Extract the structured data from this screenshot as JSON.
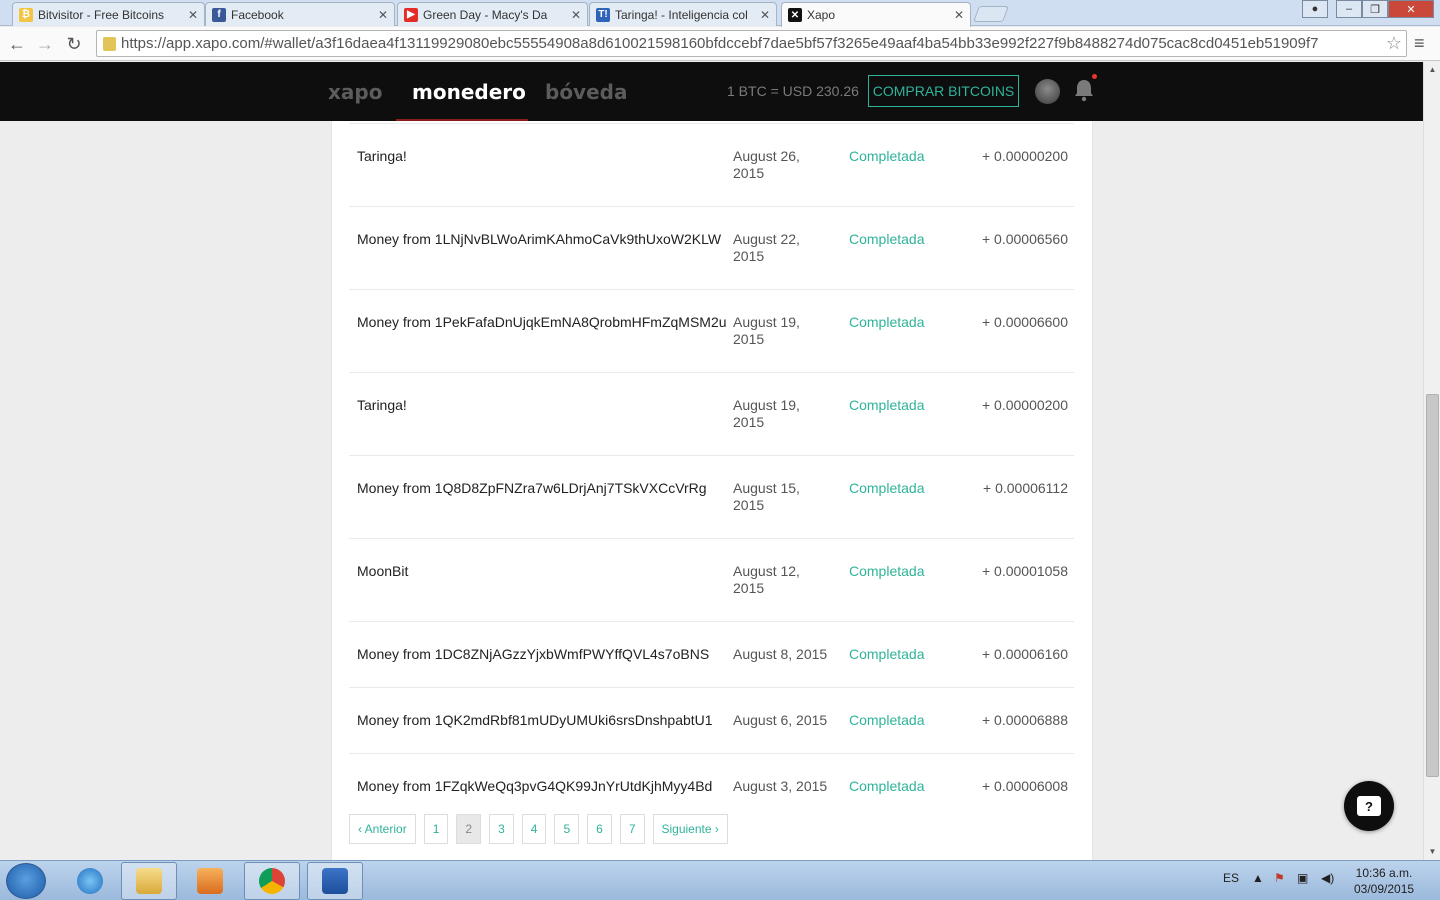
{
  "browser": {
    "tabs": [
      {
        "label": "Bitvisitor - Free Bitcoins",
        "icon": "bitvisitor-icon",
        "color": "#f4c542",
        "glyph": "₿"
      },
      {
        "label": "Facebook",
        "icon": "facebook-icon",
        "color": "#3b5998",
        "glyph": "f"
      },
      {
        "label": "Green Day - Macy's Da",
        "icon": "youtube-icon",
        "color": "#e52d27",
        "glyph": "▶"
      },
      {
        "label": "Taringa! - Inteligencia col",
        "icon": "taringa-icon",
        "color": "#2d63b8",
        "glyph": "T!"
      },
      {
        "label": "Xapo",
        "icon": "xapo-icon",
        "color": "#111111",
        "glyph": "✕"
      }
    ],
    "url": "https://app.xapo.com/#wallet/a3f16daea4f13119929080ebc55554908a8d610021598160bfdccebf7dae5bf57f3265e49aaf4ba54bb33e992f227f9b8488274d075cac8cd0451eb51909f7"
  },
  "header": {
    "brand_xapo": "xapo",
    "brand_monedero": "monedero",
    "brand_boveda": "bóveda",
    "rate": "1 BTC = USD 230.26",
    "buy_label": "COMPRAR BITCOINS",
    "accent": "#2fb39a"
  },
  "transactions": [
    {
      "desc": "Taringa!",
      "date": "August 26, 2015",
      "status": "Completada",
      "amount": "+ 0.00000200"
    },
    {
      "desc": "Money from 1LNjNvBLWoArimKAhmoCaVk9thUxoW2KLW",
      "date": "August 22, 2015",
      "status": "Completada",
      "amount": "+ 0.00006560"
    },
    {
      "desc": "Money from 1PekFafaDnUjqkEmNA8QrobmHFmZqMSM2u",
      "date": "August 19, 2015",
      "status": "Completada",
      "amount": "+ 0.00006600"
    },
    {
      "desc": "Taringa!",
      "date": "August 19, 2015",
      "status": "Completada",
      "amount": "+ 0.00000200"
    },
    {
      "desc": "Money from 1Q8D8ZpFNZra7w6LDrjAnj7TSkVXCcVrRg",
      "date": "August 15, 2015",
      "status": "Completada",
      "amount": "+ 0.00006112"
    },
    {
      "desc": "MoonBit",
      "date": "August 12, 2015",
      "status": "Completada",
      "amount": "+ 0.00001058"
    },
    {
      "desc": "Money from 1DC8ZNjAGzzYjxbWmfPWYffQVL4s7oBNS",
      "date": "August 8, 2015",
      "status": "Completada",
      "amount": "+ 0.00006160"
    },
    {
      "desc": "Money from 1QK2mdRbf81mUDyUMUki6srsDnshpabtU1",
      "date": "August 6, 2015",
      "status": "Completada",
      "amount": "+ 0.00006888"
    },
    {
      "desc": "Money from 1FZqkWeQq3pvG4QK99JnYrUtdKjhMyy4Bd",
      "date": "August 3, 2015",
      "status": "Completada",
      "amount": "+ 0.00006008"
    }
  ],
  "pagination": {
    "prev": "‹ Anterior",
    "pages": [
      "1",
      "2",
      "3",
      "4",
      "5",
      "6",
      "7"
    ],
    "current": "2",
    "next": "Siguiente ›"
  },
  "taskbar": {
    "lang": "ES",
    "time": "10:36 a.m.",
    "date": "03/09/2015"
  }
}
